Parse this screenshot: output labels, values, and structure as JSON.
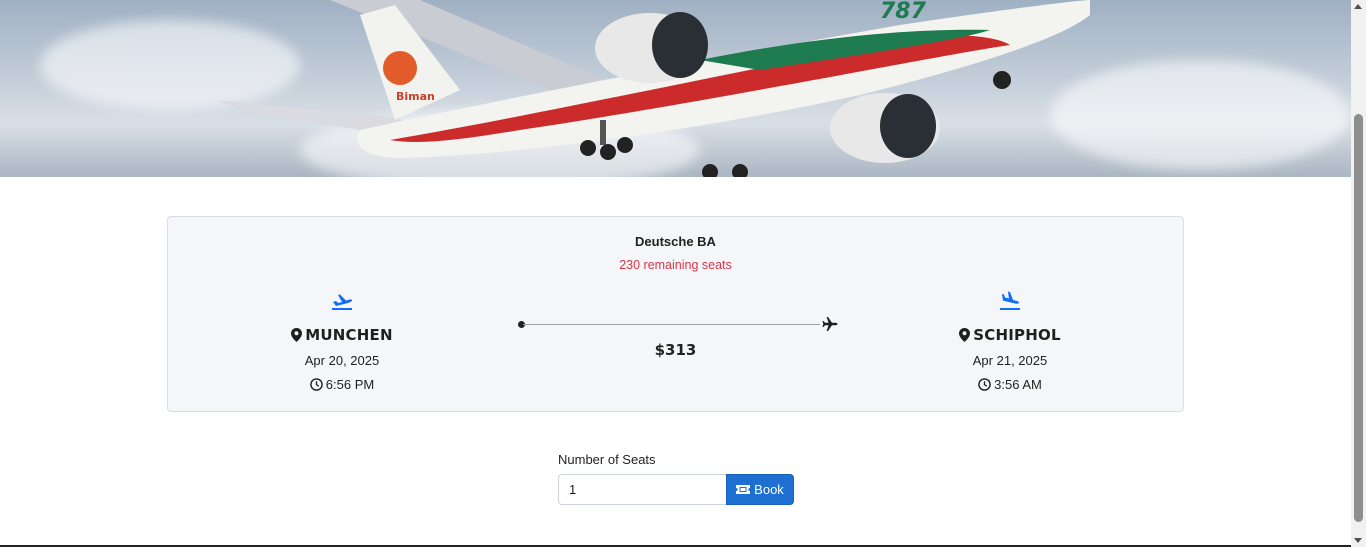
{
  "hero": {
    "image": "airliner-in-flight-photo",
    "aircraft_livery": "Biman",
    "tail_text": "787"
  },
  "flight": {
    "airline": "Deutsche BA",
    "remaining_seats": "230 remaining seats",
    "price": "$313",
    "departure": {
      "city": "MUNCHEN",
      "date": "Apr 20, 2025",
      "time": "6:56 PM",
      "icon": "plane-departure-icon"
    },
    "arrival": {
      "city": "SCHIPHOL",
      "date": "Apr 21, 2025",
      "time": "3:56 AM",
      "icon": "plane-arrival-icon"
    }
  },
  "booking": {
    "seats_label": "Number of Seats",
    "seats_value": "1",
    "book_label": "Book",
    "book_icon": "ticket-icon"
  },
  "colors": {
    "accent": "#0d6efd",
    "button": "#1d6fd1",
    "seats_text": "#dc3545",
    "card_bg": "#f4f6f9"
  }
}
